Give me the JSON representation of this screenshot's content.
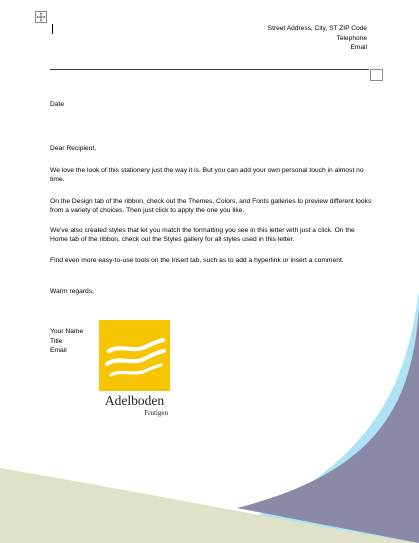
{
  "header": {
    "address": "Street Address, City, ST ZIP Code",
    "telephone": "Telephone",
    "email": "Email"
  },
  "letter": {
    "date": "Date",
    "salutation": "Dear Recipient,",
    "paragraphs": [
      "We love the look of this stationery just the way it is. But you can add your own personal touch in almost no time.",
      "On the Design tab of the ribbon, check out the Themes, Colors, and Fonts galleries to preview different looks from a variety of choices. Then just click to apply the one you like.",
      "We’ve also created styles that let you match the formatting you see in this letter with just a click. On the Home tab of the ribbon, check out the Styles gallery for all styles used in this letter.",
      "Find even more easy-to-use tools on the Insert tab, such as to add a hyperlink or insert a comment."
    ],
    "closing": "Warm regards,"
  },
  "signature": {
    "name": "Your Name",
    "title": "Title",
    "email": "Email"
  },
  "logo": {
    "name": "Adelboden",
    "subtitle": "Frutigen",
    "color": "#f6c400"
  },
  "colors": {
    "olive_band": "#dfe2c6",
    "light_blue_band": "#aee3f5",
    "slate_band": "#8a8aa6"
  },
  "icons": {
    "table_move_handle": "four-arrows-move-icon"
  }
}
